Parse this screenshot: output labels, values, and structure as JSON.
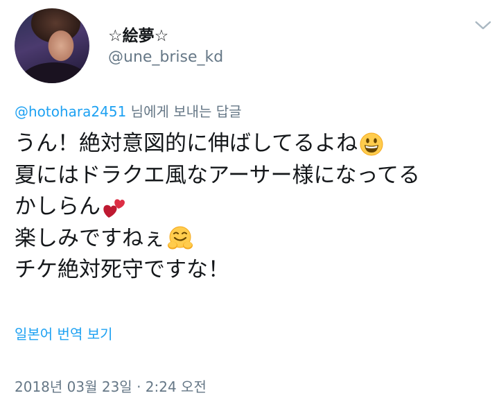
{
  "author": {
    "display_name": "☆絵夢☆",
    "handle": "@une_brise_kd"
  },
  "reply": {
    "mention": "@hotohara2451",
    "suffix": " 님에게 보내는 답글"
  },
  "tweet": {
    "lines": [
      "うん！絶対意図的に伸ばしてるよね",
      "夏にはドラクエ風なアーサー様になってる",
      "かしらん",
      "楽しみですねぇ",
      "チケ絶対死守ですな！"
    ],
    "emojis": [
      "grinning-face-icon",
      "two-hearts-icon",
      "hugging-face-icon"
    ]
  },
  "translate_link": "일본어 번역 보기",
  "timestamp": "2018년 03월 23일 · 2:24 오전",
  "colors": {
    "link": "#1da1f2",
    "secondary": "#657786",
    "text": "#14171a"
  }
}
